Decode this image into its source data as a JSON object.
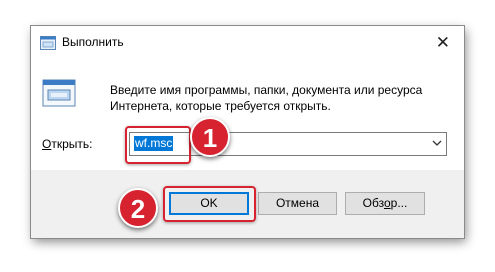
{
  "window": {
    "title": "Выполнить",
    "close_glyph": "✕"
  },
  "description": {
    "line1": "Введите имя программы, папки, документа или ресурса",
    "line2": "Интернета, которые требуется открыть."
  },
  "open_field": {
    "label_underlined": "О",
    "label_rest": "ткрыть:",
    "value": "wf.msc"
  },
  "buttons": {
    "ok": "OK",
    "cancel": "Отмена",
    "browse_pre": "Обз",
    "browse_underlined": "о",
    "browse_post": "р..."
  },
  "annotations": {
    "step1": "1",
    "step2": "2",
    "color": "#d6232f"
  },
  "icons": {
    "title": "run-icon",
    "large": "run-app-icon",
    "dropdown": "chevron-down-icon"
  }
}
